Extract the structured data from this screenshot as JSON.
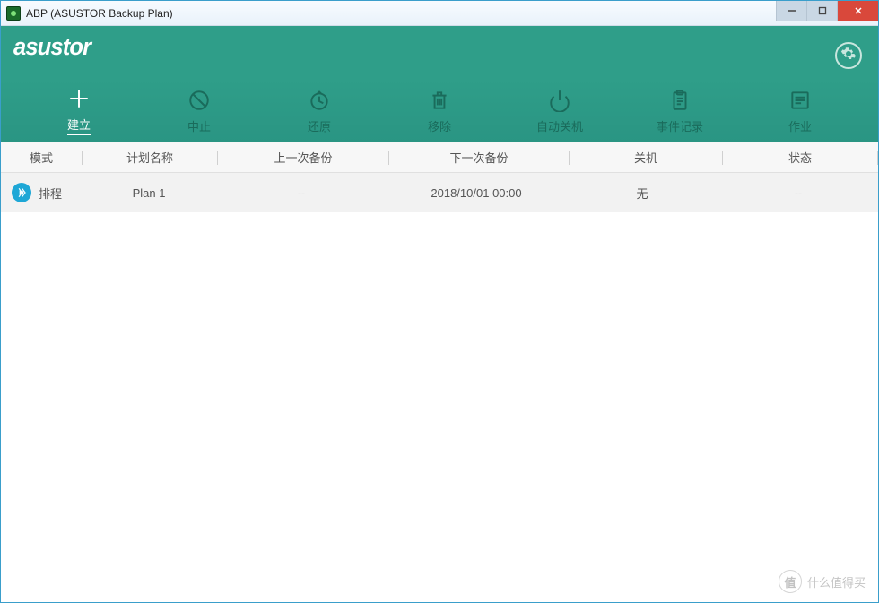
{
  "window": {
    "title": "ABP (ASUSTOR Backup Plan)"
  },
  "brand": "asustor",
  "toolbar": {
    "create": "建立",
    "stop": "中止",
    "restore": "还原",
    "remove": "移除",
    "autoShutdown": "自动关机",
    "eventLog": "事件记录",
    "jobs": "作业"
  },
  "columns": {
    "mode": "模式",
    "name": "计划名称",
    "lastBackup": "上一次备份",
    "nextBackup": "下一次备份",
    "shutdown": "关机",
    "status": "状态"
  },
  "rows": [
    {
      "mode": "排程",
      "name": "Plan 1",
      "lastBackup": "--",
      "nextBackup": "2018/10/01 00:00",
      "shutdown": "无",
      "status": "--"
    }
  ],
  "watermark": {
    "badge": "值",
    "text": "什么值得买"
  }
}
